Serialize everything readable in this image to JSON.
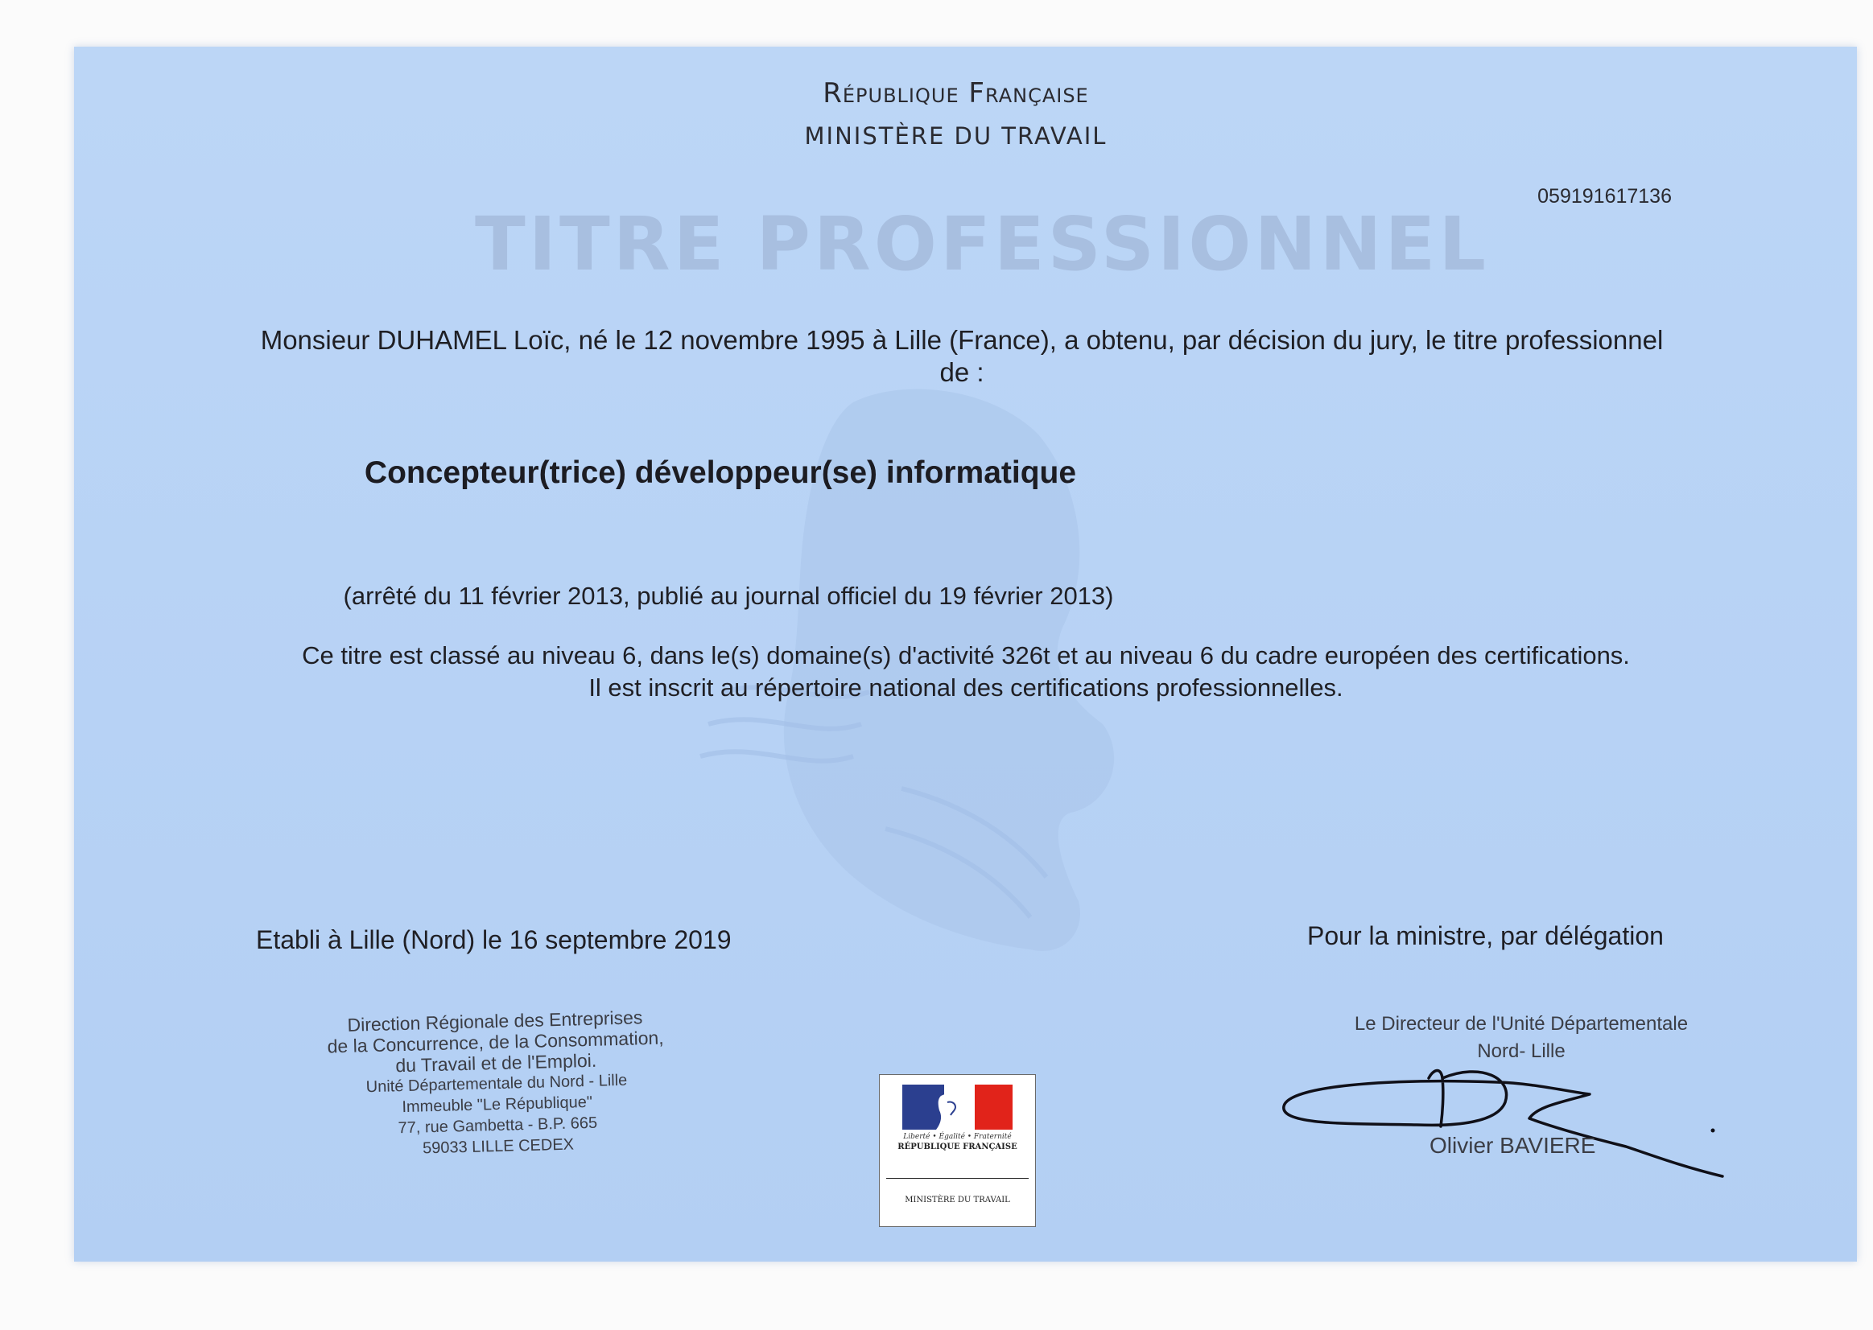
{
  "header": {
    "republic": "République Française",
    "ministry": "MINISTÈRE DU TRAVAIL"
  },
  "certificate_number": "059191617136",
  "title_banner": "TITRE PROFESSIONNEL",
  "recipient": {
    "statement_line1": "Monsieur DUHAMEL Loïc, né le 12 novembre 1995 à Lille (France), a obtenu, par décision du jury, le titre professionnel",
    "statement_line2": "de :"
  },
  "diploma_name": "Concepteur(trice) développeur(se) informatique",
  "decree_reference": "(arrêté du 11 février 2013, publié au journal officiel du 19 février 2013)",
  "classification": {
    "line1": "Ce titre est classé au niveau 6, dans le(s) domaine(s) d'activité 326t et au niveau 6 du cadre européen des certifications.",
    "line2": "Il est inscrit au répertoire national des certifications professionnelles."
  },
  "issue_place_date": "Etabli à Lille (Nord) le 16 septembre 2019",
  "delegation": "Pour la ministre, par délégation",
  "administration_stamp": {
    "line1": "Direction Régionale des Entreprises",
    "line2": "de la Concurrence, de la Consommation,",
    "line3": "du Travail et de l'Emploi.",
    "line4": "Unité Départementale du Nord - Lille",
    "line5": "Immeuble \"Le République\"",
    "line6": "77, rue Gambetta - B.P. 665",
    "line7": "59033 LILLE CEDEX"
  },
  "signatory": {
    "title_line1": "Le Directeur de l'Unité Départementale",
    "title_line2": "Nord- Lille",
    "name": "Olivier BAVIERE"
  },
  "logo": {
    "motto": "Liberté • Égalité • Fraternité",
    "republic_label": "RÉPUBLIQUE FRANÇAISE",
    "ministry_label": "MINISTÈRE DU TRAVAIL",
    "colors": {
      "blue": "#2b3f8f",
      "white": "#ffffff",
      "red": "#e1231a"
    }
  },
  "colors": {
    "paper": "#bcd6f6",
    "title_banner": "#a8bfe0",
    "text": "#1f1f24"
  }
}
